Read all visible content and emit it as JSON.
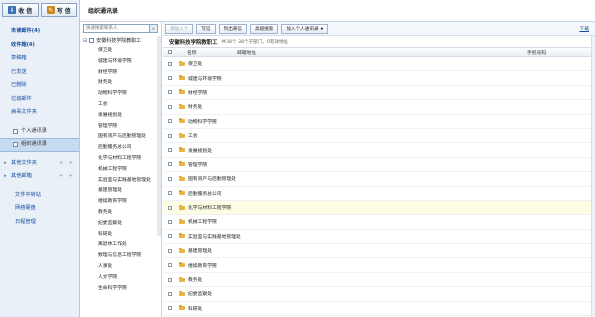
{
  "app": {
    "receive_label": "收 信",
    "compose_label": "写 信"
  },
  "nav": {
    "items": [
      {
        "label": "未读邮件(4)",
        "bold": true
      },
      {
        "label": "收件箱(4)",
        "bold": true
      },
      {
        "label": "草稿箱"
      },
      {
        "label": "已发送"
      },
      {
        "label": "已删除"
      },
      {
        "label": "垃圾邮件"
      },
      {
        "label": "病毒文件夹"
      }
    ],
    "contacts": [
      {
        "label": "个人通讯录"
      },
      {
        "label": "组织通讯录"
      }
    ],
    "groups": [
      {
        "label": "其他文件夹"
      },
      {
        "label": "其他邮箱"
      }
    ],
    "tools": [
      {
        "label": "文件中转站"
      },
      {
        "label": "网络硬盘"
      },
      {
        "label": "日程管理"
      }
    ]
  },
  "page": {
    "title": "组织通讯录"
  },
  "tree": {
    "search_placeholder": "快速搜索联系人",
    "root": "安徽科技学院教职工",
    "items": [
      "保卫处",
      "城建与环境学院",
      "财经学院",
      "财务处",
      "动物科学学院",
      "工会",
      "发展规划处",
      "管理学院",
      "国有资产与后勤管理处",
      "后勤服务总公司",
      "化学与材料工程学院",
      "机械工程学院",
      "实验室与实践基地管理处",
      "基建管理处",
      "继续教育学院",
      "教务处",
      "纪委监察处",
      "科研处",
      "离退休工作处",
      "数理与信息工程学院",
      "人事处",
      "人文学院",
      "生命科学学院"
    ]
  },
  "toolbar": {
    "add_contact": "添加入个",
    "write": "写信",
    "blocklist": "列出来信",
    "advanced": "高级搜索",
    "add_to_personal": "加入个人通讯录",
    "download": "下载"
  },
  "header": {
    "org_name": "安徽科技学院教职工",
    "meta": "共38个 38个子部门，0有效地址"
  },
  "table": {
    "columns": {
      "name": "名称",
      "email": "邮箱地址",
      "phone": "手机号码"
    },
    "rows": [
      {
        "name": "保卫处"
      },
      {
        "name": "城建与环境学院"
      },
      {
        "name": "财经学院"
      },
      {
        "name": "财务处"
      },
      {
        "name": "动物科学学院"
      },
      {
        "name": "工会"
      },
      {
        "name": "发展规划处"
      },
      {
        "name": "管理学院"
      },
      {
        "name": "国有资产与后勤管理处"
      },
      {
        "name": "后勤服务总公司"
      },
      {
        "name": "化学与材料工程学院",
        "highlight": true
      },
      {
        "name": "机械工程学院"
      },
      {
        "name": "实验室与实践基地管理处"
      },
      {
        "name": "基建管理处"
      },
      {
        "name": "继续教育学院"
      },
      {
        "name": "教务处"
      },
      {
        "name": "纪委监察处"
      },
      {
        "name": "科研处"
      }
    ]
  }
}
